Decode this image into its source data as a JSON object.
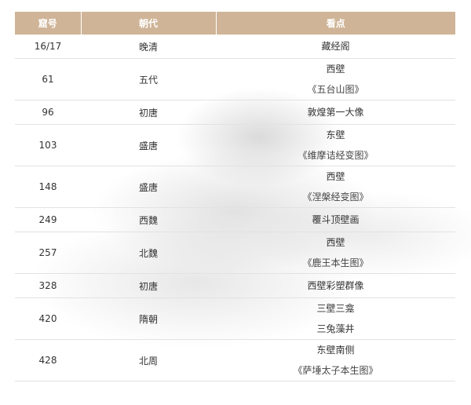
{
  "table": {
    "headers": {
      "cave": "窟号",
      "dynasty": "朝代",
      "sights": "看点"
    },
    "rows": [
      {
        "cave": "16/17",
        "dynasty": "晚清",
        "sights": [
          "藏经阁"
        ]
      },
      {
        "cave": "61",
        "dynasty": "五代",
        "sights": [
          "西壁",
          "《五台山图》"
        ]
      },
      {
        "cave": "96",
        "dynasty": "初唐",
        "sights": [
          "敦煌第一大像"
        ]
      },
      {
        "cave": "103",
        "dynasty": "盛唐",
        "sights": [
          "东壁",
          "《维摩诘经变图》"
        ]
      },
      {
        "cave": "148",
        "dynasty": "盛唐",
        "sights": [
          "西壁",
          "《涅槃经变图》"
        ]
      },
      {
        "cave": "249",
        "dynasty": "西魏",
        "sights": [
          "覆斗顶壁画"
        ]
      },
      {
        "cave": "257",
        "dynasty": "北魏",
        "sights": [
          "西壁",
          "《鹿王本生图》"
        ]
      },
      {
        "cave": "328",
        "dynasty": "初唐",
        "sights": [
          "西壁彩塑群像"
        ]
      },
      {
        "cave": "420",
        "dynasty": "隋朝",
        "sights": [
          "三壁三龛",
          "三兔藻井"
        ]
      },
      {
        "cave": "428",
        "dynasty": "北周",
        "sights": [
          "东壁南侧",
          "《萨埵太子本生图》"
        ]
      }
    ]
  },
  "colors": {
    "header_bg": "#cfb497",
    "header_text": "#ffffff",
    "row_divider": "#e2e2e2"
  }
}
